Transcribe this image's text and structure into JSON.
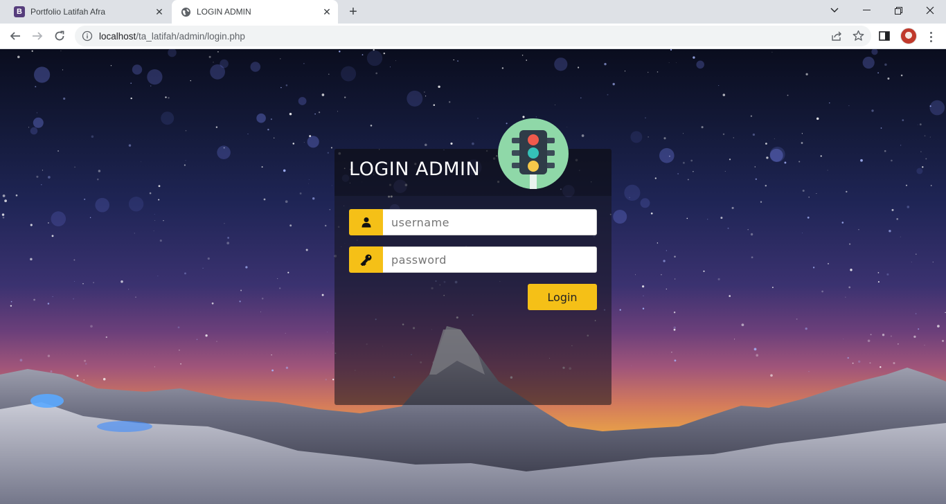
{
  "browser": {
    "tabs": [
      {
        "title": "Portfolio Latifah Afra",
        "favicon": "bootstrap-icon",
        "favicon_letter": "B",
        "active": false
      },
      {
        "title": "LOGIN ADMIN",
        "favicon": "globe-icon",
        "active": true
      }
    ],
    "address": {
      "host": "localhost",
      "path": "/ta_latifah/admin/login.php"
    }
  },
  "login": {
    "title": "LOGIN ADMIN",
    "logo": "traffic-light-icon",
    "username_placeholder": "username",
    "password_placeholder": "password",
    "username_icon": "user-icon",
    "password_icon": "key-icon",
    "submit_label": "Login"
  },
  "colors": {
    "accent": "#f5c017",
    "logo_bg": "#8fd8a8",
    "light_red": "#ef5a4c",
    "light_teal": "#35c2b8",
    "light_yellow": "#f5c84a"
  }
}
